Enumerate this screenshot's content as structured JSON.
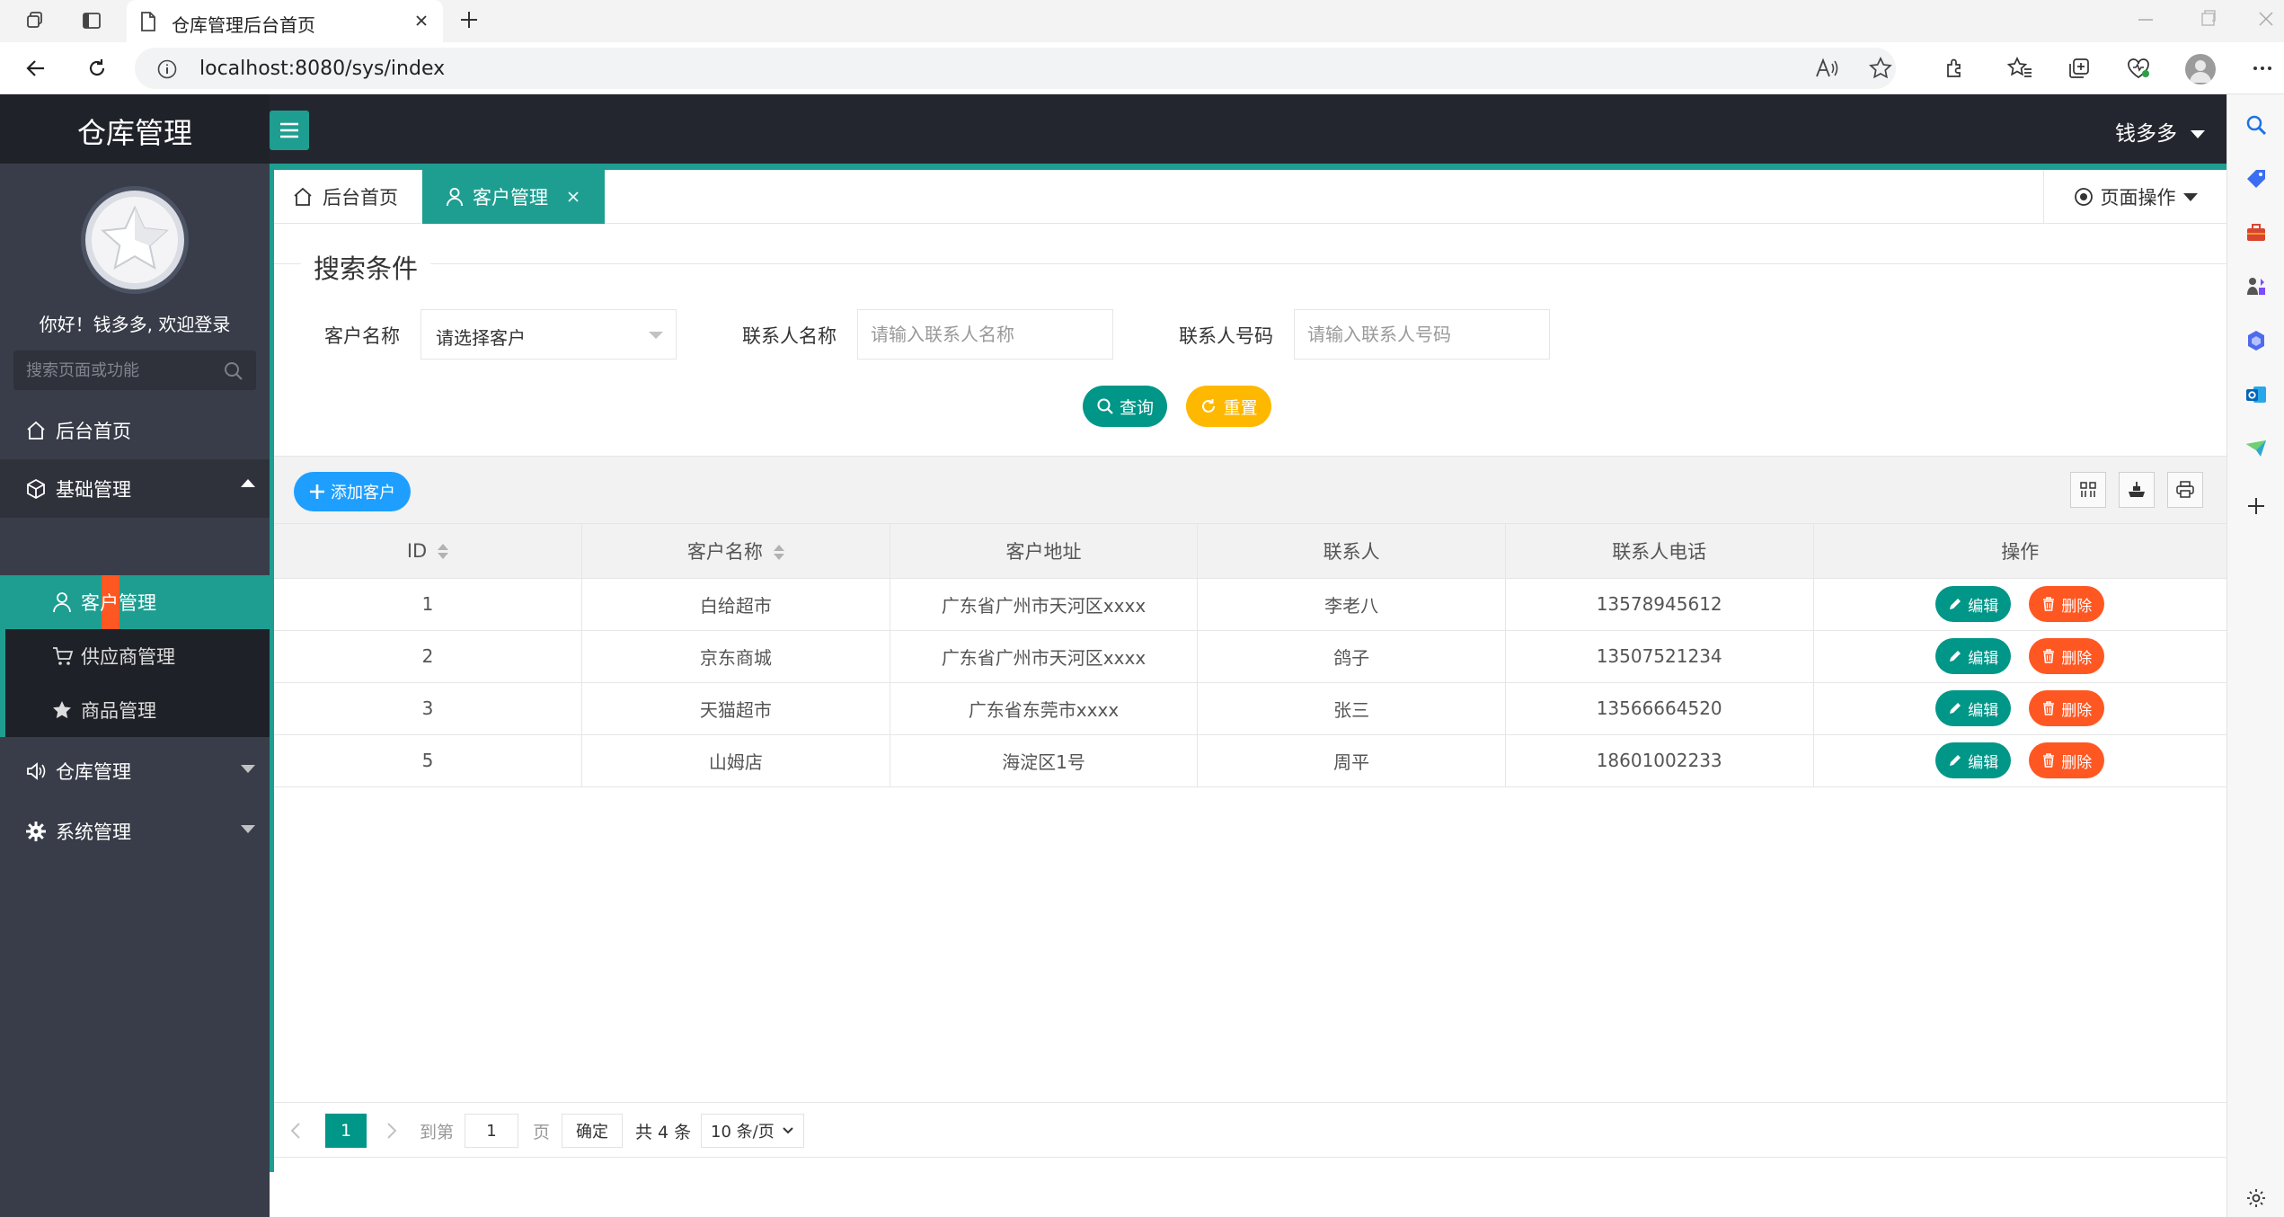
{
  "browser": {
    "tab_title": "仓库管理后台首页",
    "url": "localhost:8080/sys/index",
    "new_tab_label": "+"
  },
  "header": {
    "logo": "仓库管理",
    "user": "钱多多"
  },
  "sidebar": {
    "welcome": "你好！钱多多, 欢迎登录",
    "search_placeholder": "搜索页面或功能",
    "items": [
      {
        "label": "后台首页"
      },
      {
        "label": "基础管理",
        "children": [
          {
            "label": "客户管理"
          },
          {
            "label": "供应商管理"
          },
          {
            "label": "商品管理"
          }
        ]
      },
      {
        "label": "仓库管理"
      },
      {
        "label": "系统管理"
      }
    ]
  },
  "tabs": {
    "home": "后台首页",
    "customer": "客户管理",
    "page_ops": "页面操作"
  },
  "search": {
    "legend": "搜索条件",
    "customer_label": "客户名称",
    "customer_select": "请选择客户",
    "contact_label": "联系人名称",
    "contact_placeholder": "请输入联系人名称",
    "phone_label": "联系人号码",
    "phone_placeholder": "请输入联系人号码",
    "query_btn": "查询",
    "reset_btn": "重置"
  },
  "toolbar": {
    "add_btn": "添加客户"
  },
  "table": {
    "columns": [
      "ID",
      "客户名称",
      "客户地址",
      "联系人",
      "联系人电话",
      "操作"
    ],
    "rows": [
      {
        "id": "1",
        "name": "白给超市",
        "address": "广东省广州市天河区xxxx",
        "contact": "李老八",
        "phone": "13578945612"
      },
      {
        "id": "2",
        "name": "京东商城",
        "address": "广东省广州市天河区xxxx",
        "contact": "鸽子",
        "phone": "13507521234"
      },
      {
        "id": "3",
        "name": "天猫超市",
        "address": "广东省东莞市xxxx",
        "contact": "张三",
        "phone": "13566664520"
      },
      {
        "id": "5",
        "name": "山姆店",
        "address": "海淀区1号",
        "contact": "周平",
        "phone": "18601002233"
      }
    ],
    "edit_btn": "编辑",
    "delete_btn": "删除"
  },
  "pager": {
    "current": "1",
    "goto_label": "到第",
    "goto_value": "1",
    "page_unit": "页",
    "ok_btn": "确定",
    "total": "共 4 条",
    "page_size": "10 条/页"
  },
  "colors": {
    "accent": "#1e9e91",
    "danger": "#ff5722",
    "warning": "#ffb800",
    "info": "#1e9fff"
  }
}
